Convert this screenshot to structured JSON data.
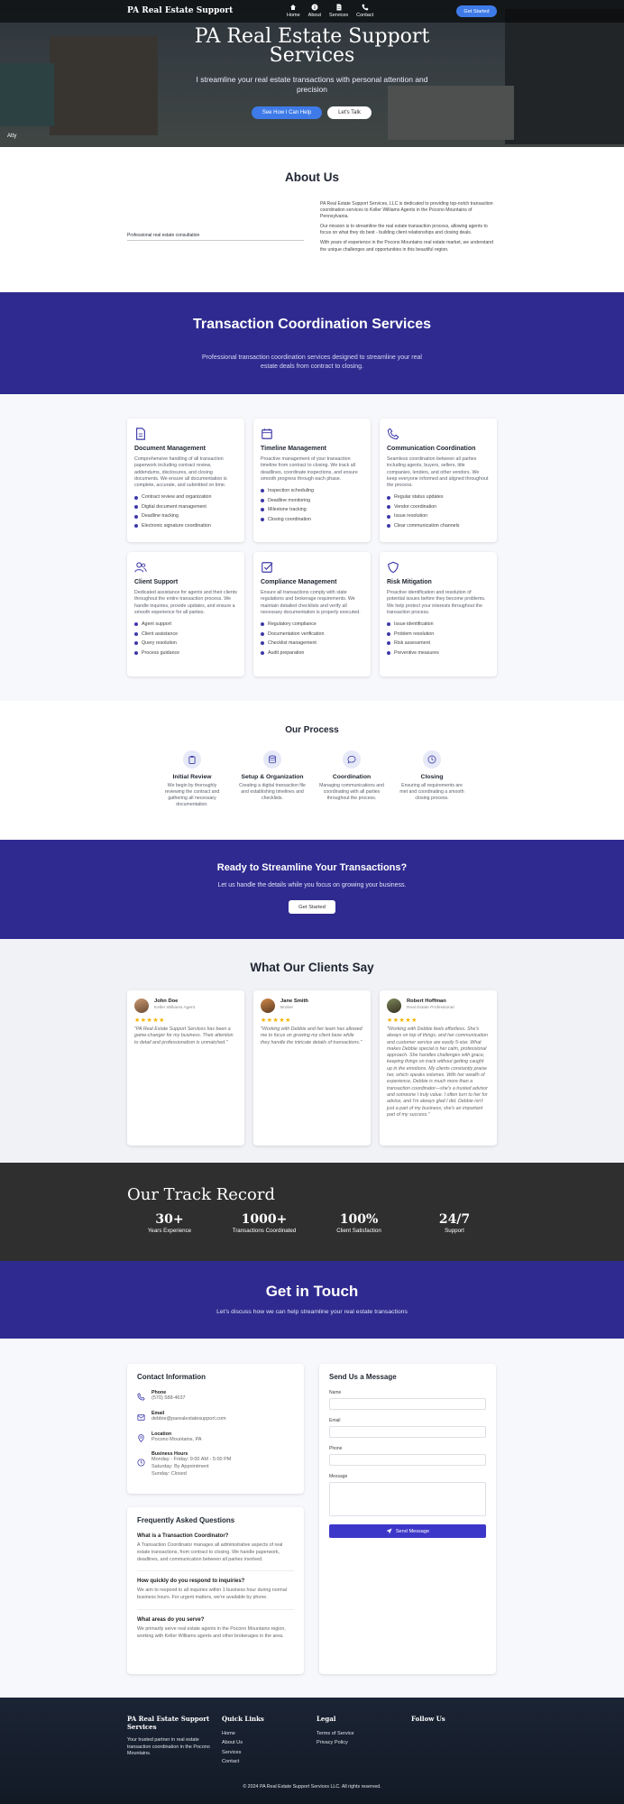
{
  "nav": {
    "brand": "PA Real Estate Support",
    "links": [
      {
        "label": "Home",
        "icon": "home-icon"
      },
      {
        "label": "About",
        "icon": "info-icon"
      },
      {
        "label": "Services",
        "icon": "document-icon"
      },
      {
        "label": "Contact",
        "icon": "phone-icon"
      }
    ],
    "cta": "Get Started"
  },
  "hero": {
    "title": "PA Real Estate Support Services",
    "subtitle": "I streamline your real estate transactions with personal attention and precision",
    "primary_button": "See How I Can Help",
    "secondary_button": "Let's Talk",
    "corner_text": "Atty"
  },
  "about": {
    "title": "About Us",
    "image_caption": "Professional real estate consultation",
    "paragraphs": [
      "PA Real Estate Support Services, LLC is dedicated to providing top-notch transaction coordination services to Keller Williams Agents in the Pocono Mountains of Pennsylvania.",
      "Our mission is to streamline the real estate transaction process, allowing agents to focus on what they do best - building client relationships and closing deals.",
      "With years of experience in the Pocono Mountains real estate market, we understand the unique challenges and opportunities in this beautiful region."
    ]
  },
  "services_banner": {
    "title": "Transaction Coordination Services",
    "subtitle": "Professional transaction coordination services designed to streamline your real estate deals from contract to closing."
  },
  "services": [
    {
      "icon": "document-icon",
      "title": "Document Management",
      "desc": "Comprehensive handling of all transaction paperwork including contract review, addendums, disclosures, and closing documents. We ensure all documentation is complete, accurate, and submitted on time.",
      "items": [
        "Contract review and organization",
        "Digital document management",
        "Deadline tracking",
        "Electronic signature coordination"
      ]
    },
    {
      "icon": "calendar-icon",
      "title": "Timeline Management",
      "desc": "Proactive management of your transaction timeline from contract to closing. We track all deadlines, coordinate inspections, and ensure smooth progress through each phase.",
      "items": [
        "Inspection scheduling",
        "Deadline monitoring",
        "Milestone tracking",
        "Closing coordination"
      ]
    },
    {
      "icon": "phone-icon",
      "title": "Communication Coordination",
      "desc": "Seamless coordination between all parties including agents, buyers, sellers, title companies, lenders, and other vendors. We keep everyone informed and aligned throughout the process.",
      "items": [
        "Regular status updates",
        "Vendor coordination",
        "Issue resolution",
        "Clear communication channels"
      ]
    },
    {
      "icon": "users-icon",
      "title": "Client Support",
      "desc": "Dedicated assistance for agents and their clients throughout the entire transaction process. We handle inquiries, provide updates, and ensure a smooth experience for all parties.",
      "items": [
        "Agent support",
        "Client assistance",
        "Query resolution",
        "Process guidance"
      ]
    },
    {
      "icon": "check-square-icon",
      "title": "Compliance Management",
      "desc": "Ensure all transactions comply with state regulations and brokerage requirements. We maintain detailed checklists and verify all necessary documentation is properly executed.",
      "items": [
        "Regulatory compliance",
        "Documentation verification",
        "Checklist management",
        "Audit preparation"
      ]
    },
    {
      "icon": "shield-icon",
      "title": "Risk Mitigation",
      "desc": "Proactive identification and resolution of potential issues before they become problems. We help protect your interests throughout the transaction process.",
      "items": [
        "Issue identification",
        "Problem resolution",
        "Risk assessment",
        "Preventive measures"
      ]
    }
  ],
  "process": {
    "title": "Our Process",
    "steps": [
      {
        "icon": "clipboard-icon",
        "title": "Initial Review",
        "desc": "We begin by thoroughly reviewing the contract and gathering all necessary documentation."
      },
      {
        "icon": "database-icon",
        "title": "Setup & Organization",
        "desc": "Creating a digital transaction file and establishing timelines and checklists."
      },
      {
        "icon": "chat-icon",
        "title": "Coordination",
        "desc": "Managing communications and coordinating with all parties throughout the process."
      },
      {
        "icon": "clock-icon",
        "title": "Closing",
        "desc": "Ensuring all requirements are met and coordinating a smooth closing process."
      }
    ]
  },
  "cta": {
    "title": "Ready to Streamline Your Transactions?",
    "subtitle": "Let us handle the details while you focus on growing your business.",
    "button": "Get Started"
  },
  "testimonials": {
    "title": "What Our Clients Say",
    "items": [
      {
        "name": "John Doe",
        "role": "Keller Williams Agent",
        "stars": "★★★★★",
        "quote": "\"PA Real Estate Support Services has been a game-changer for my business. Their attention to detail and professionalism is unmatched.\""
      },
      {
        "name": "Jane Smith",
        "role": "Broker",
        "stars": "★★★★★",
        "quote": "\"Working with Debbie and her team has allowed me to focus on growing my client base while they handle the intricate details of transactions.\""
      },
      {
        "name": "Robert Hoffman",
        "role": "Real Estate Professional",
        "stars": "★★★★★",
        "quote": "\"Working with Debbie feels effortless. She's always on top of things, and her communication and customer service are easily 5-star. What makes Debbie special is her calm, professional approach. She handles challenges with grace, keeping things on track without getting caught up in the emotions. My clients constantly praise her, which speaks volumes. With her wealth of experience, Debbie is much more than a transaction coordinator—she's a trusted advisor and someone I truly value. I often turn to her for advice, and I'm always glad I did. Debbie isn't just a part of my business; she's an important part of my success.\""
      }
    ]
  },
  "track": {
    "title": "Our Track Record",
    "stats": [
      {
        "num": "30+",
        "label": "Years Experience"
      },
      {
        "num": "1000+",
        "label": "Transactions Coordinated"
      },
      {
        "num": "100%",
        "label": "Client Satisfaction"
      },
      {
        "num": "24/7",
        "label": "Support"
      }
    ]
  },
  "contact_banner": {
    "title": "Get in Touch",
    "subtitle": "Let's discuss how we can help streamline your real estate transactions"
  },
  "contact_info": {
    "title": "Contact Information",
    "phone_label": "Phone",
    "phone": "(570) 588-4637",
    "email_label": "Email",
    "email": "debbie@parealestatesupport.com",
    "location_label": "Location",
    "location": "Pocono Mountains, PA",
    "hours_label": "Business Hours",
    "hours": [
      "Monday - Friday: 9:00 AM - 5:00 PM",
      "Saturday: By Appointment",
      "Sunday: Closed"
    ]
  },
  "form": {
    "title": "Send Us a Message",
    "name_label": "Name",
    "email_label": "Email",
    "phone_label": "Phone",
    "message_label": "Message",
    "submit": "Send Message"
  },
  "faq": {
    "title": "Frequently Asked Questions",
    "items": [
      {
        "q": "What is a Transaction Coordinator?",
        "a": "A Transaction Coordinator manages all administrative aspects of real estate transactions, from contract to closing. We handle paperwork, deadlines, and communication between all parties involved."
      },
      {
        "q": "How quickly do you respond to inquiries?",
        "a": "We aim to respond to all inquiries within 1 business hour during normal business hours. For urgent matters, we're available by phone."
      },
      {
        "q": "What areas do you serve?",
        "a": "We primarily serve real estate agents in the Pocono Mountains region, working with Keller Williams agents and other brokerages in the area."
      }
    ]
  },
  "footer": {
    "brand": "PA Real Estate Support Services",
    "desc": "Your trusted partner in real estate transaction coordination in the Pocono Mountains.",
    "quick_title": "Quick Links",
    "quick": [
      "Home",
      "About Us",
      "Services",
      "Contact"
    ],
    "legal_title": "Legal",
    "legal": [
      "Terms of Service",
      "Privacy Policy"
    ],
    "follow_title": "Follow Us",
    "copyright": "© 2024 PA Real Estate Support Services LLC. All rights reserved."
  },
  "colors": {
    "primary": "#2f2a8f",
    "accent": "#3e7be8",
    "star": "#f5b400",
    "dark": "#2f2f2f"
  }
}
